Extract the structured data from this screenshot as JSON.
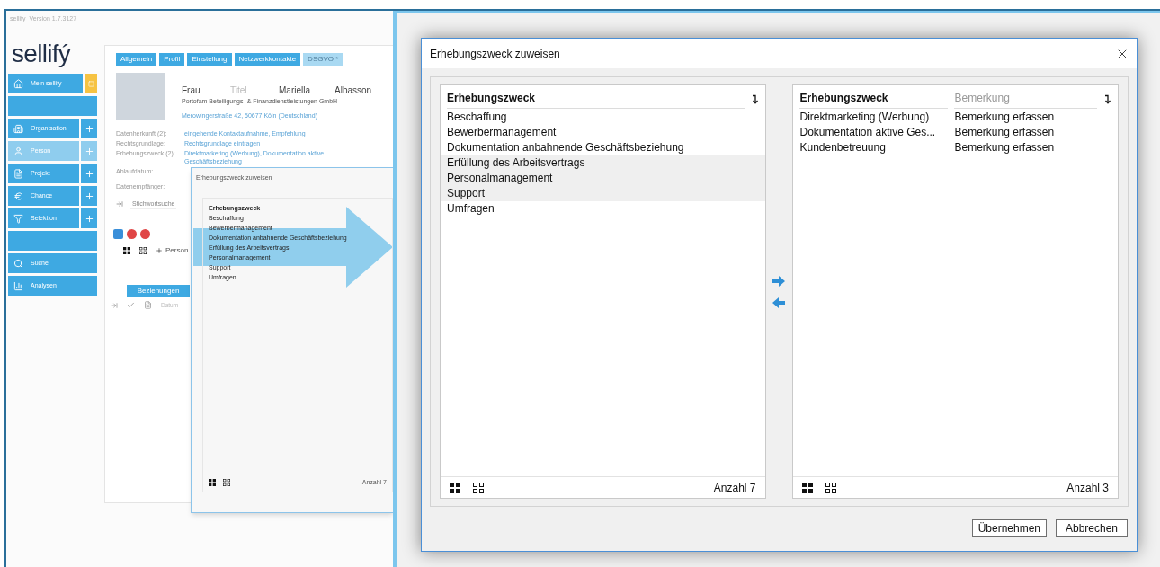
{
  "app": {
    "name": "sellify",
    "version": "Version 1.7.3127",
    "logo": "sellifý"
  },
  "sidebar": {
    "sections": [
      [
        {
          "label": "Mein sellify",
          "selected": false,
          "add": false,
          "badge": true
        }
      ],
      [
        {
          "label": "Organisation",
          "selected": false,
          "add": true,
          "badge": false
        },
        {
          "label": "Person",
          "selected": true,
          "add": true,
          "badge": false
        },
        {
          "label": "Projekt",
          "selected": false,
          "add": true,
          "badge": false
        },
        {
          "label": "Chance",
          "selected": false,
          "add": true,
          "badge": false
        },
        {
          "label": "Selektion",
          "selected": false,
          "add": true,
          "badge": false
        }
      ],
      [
        {
          "label": "Suche",
          "selected": false,
          "add": false,
          "badge": false
        },
        {
          "label": "Analysen",
          "selected": false,
          "add": false,
          "badge": false
        }
      ]
    ]
  },
  "tabs": [
    {
      "label": "Allgemein",
      "selected": false
    },
    {
      "label": "Profil",
      "selected": false
    },
    {
      "label": "Einstellung",
      "selected": false
    },
    {
      "label": "Netzwerkkontakte",
      "selected": false
    },
    {
      "label": "DSGVO *",
      "selected": true
    }
  ],
  "person": {
    "salutation": "Frau",
    "title_placeholder": "Titel",
    "first_name": "Mariella",
    "last_name": "Albasson",
    "company": "Portofam Beteiligungs- & Finanzdienstleistungen GmbH",
    "address": "Merowingerstraße 42, 50677 Köln (Deutschland)"
  },
  "fields": [
    {
      "label": "Datenherkunft (2):",
      "value": "eingehende Kontaktaufnahme, Empfehlung"
    },
    {
      "label": "Rechtsgrundlage:",
      "value": "Rechtsgrundlage eintragen"
    },
    {
      "label": "Erhebungszweck (2):",
      "value": "Direktmarketing (Werbung), Dokumentation aktive Geschäftsbeziehung"
    },
    {
      "label": "Ablaufdatum:"
    }
  ],
  "recipients": {
    "label": "Datenempfänger:",
    "placeholder": "Stichwortsuche"
  },
  "add_person": "Person",
  "small_dialog": {
    "title": "Erhebungszweck zuweisen",
    "column": "Erhebungszweck",
    "items": [
      "Beschaffung",
      "Bewerbermanagement",
      "Dokumentation anbahnende Geschäftsbeziehung",
      "Erfüllung des Arbeitsvertrags",
      "Personalmanagement",
      "Support",
      "Umfragen"
    ],
    "count": "Anzahl 7"
  },
  "relations": {
    "tab": "Beziehungen",
    "column": "Datum"
  },
  "dialog": {
    "title": "Erhebungszweck zuweisen",
    "available": {
      "column": "Erhebungszweck",
      "count": "Anzahl 7",
      "items": [
        {
          "label": "Beschaffung",
          "selected": false
        },
        {
          "label": "Bewerbermanagement",
          "selected": false
        },
        {
          "label": "Dokumentation anbahnende Geschäftsbeziehung",
          "selected": false
        },
        {
          "label": "Erfüllung des Arbeitsvertrags",
          "selected": true
        },
        {
          "label": "Personalmanagement",
          "selected": true
        },
        {
          "label": "Support",
          "selected": true
        },
        {
          "label": "Umfragen",
          "selected": false
        }
      ]
    },
    "assigned": {
      "columns": [
        "Erhebungszweck",
        "Bemerkung"
      ],
      "count": "Anzahl 3",
      "rows": [
        {
          "purpose": "Direktmarketing (Werbung)",
          "remark": "Bemerkung erfassen"
        },
        {
          "purpose": "Dokumentation aktive Ges...",
          "remark": "Bemerkung erfassen"
        },
        {
          "purpose": "Kundenbetreuung",
          "remark": "Bemerkung erfassen"
        }
      ]
    },
    "buttons": [
      "Übernehmen",
      "Abbrechen"
    ]
  }
}
